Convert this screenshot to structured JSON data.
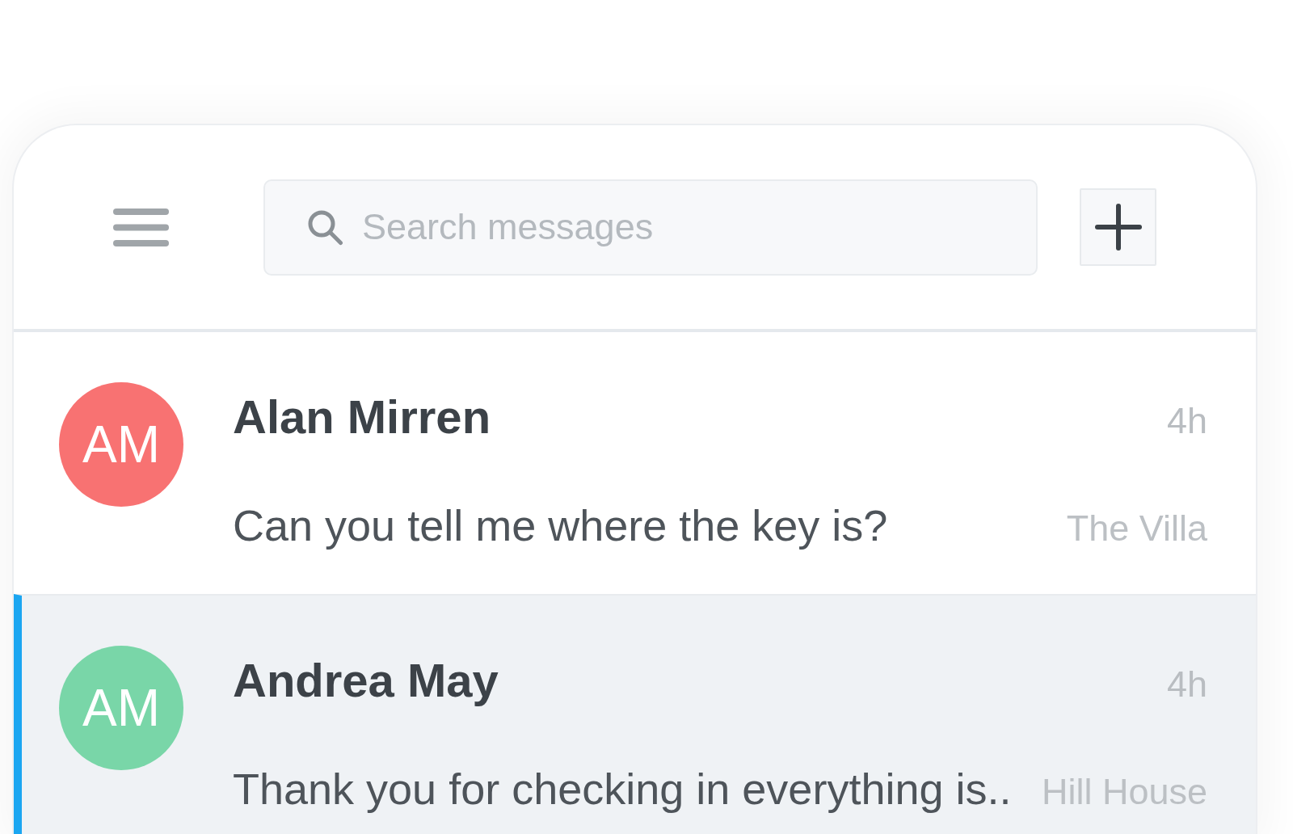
{
  "header": {
    "search": {
      "placeholder": "Search messages"
    }
  },
  "conversations": [
    {
      "initials": "AM",
      "color": "#f87272",
      "name": "Alan Mirren",
      "time": "4h",
      "preview": "Can you tell me where the key is?",
      "property": "The Villa",
      "selected": false
    },
    {
      "initials": "AM",
      "color": "#79d6a8",
      "name": "Andrea May",
      "time": "4h",
      "preview": "Thank you for checking in everything is..",
      "property": "Hill House",
      "selected": true
    }
  ]
}
